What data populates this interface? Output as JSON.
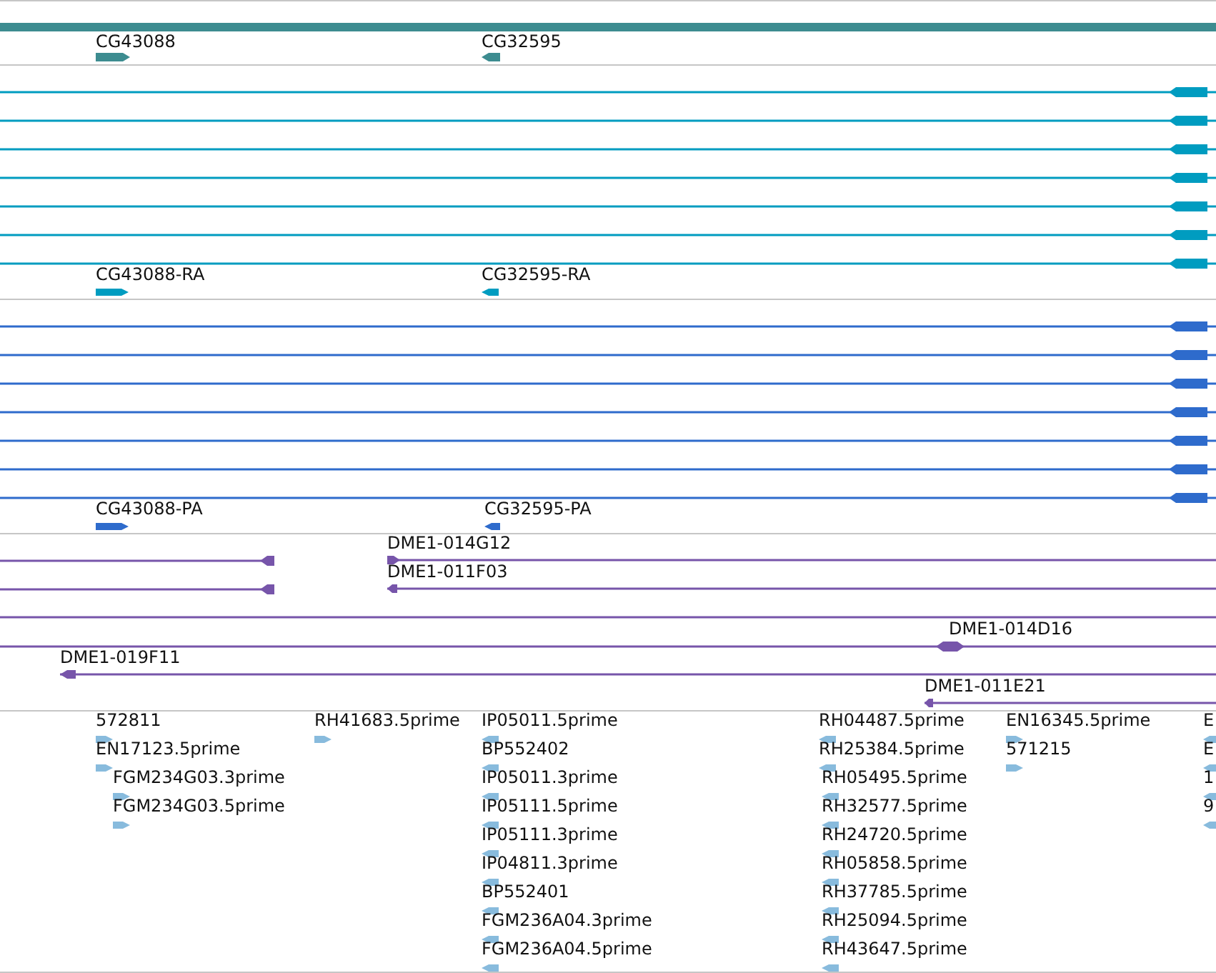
{
  "tracks": [
    {
      "kind": "gene",
      "features": [
        {
          "label": "CG43088",
          "forward": true,
          "reverse": false
        },
        {
          "label": "CG32595",
          "forward": false,
          "reverse": true
        }
      ]
    },
    {
      "kind": "transcript",
      "features": [
        {
          "forward": false,
          "reverse": true
        },
        {
          "forward": false,
          "reverse": true
        },
        {
          "forward": false,
          "reverse": true
        },
        {
          "forward": false,
          "reverse": true
        },
        {
          "forward": false,
          "reverse": true
        },
        {
          "forward": false,
          "reverse": true
        },
        {
          "forward": false,
          "reverse": true
        },
        {
          "label": "CG43088-RA",
          "forward": true,
          "reverse": false
        },
        {
          "label": "CG32595-RA",
          "forward": false,
          "reverse": true
        }
      ]
    },
    {
      "kind": "protein",
      "features": [
        {
          "forward": false,
          "reverse": true
        },
        {
          "forward": false,
          "reverse": true
        },
        {
          "forward": false,
          "reverse": true
        },
        {
          "forward": false,
          "reverse": true
        },
        {
          "forward": false,
          "reverse": true
        },
        {
          "forward": false,
          "reverse": true
        },
        {
          "forward": false,
          "reverse": true
        },
        {
          "label": "CG43088-PA",
          "forward": true,
          "reverse": false
        },
        {
          "label": "CG32595-PA",
          "forward": false,
          "reverse": true
        }
      ]
    },
    {
      "kind": "clone",
      "features": [
        {
          "forward": false,
          "reverse": true
        },
        {
          "label": "DME1-014G12",
          "forward": true,
          "reverse": false
        },
        {
          "forward": false,
          "reverse": true
        },
        {
          "label": "DME1-011F03",
          "forward": false,
          "reverse": true
        },
        {
          "kind": "line"
        },
        {
          "label": "DME1-014D16",
          "forward": true,
          "reverse": true
        },
        {
          "label": "DME1-019F11",
          "forward": false,
          "reverse": true
        },
        {
          "label": "DME1-011E21",
          "forward": false,
          "reverse": true
        }
      ]
    },
    {
      "kind": "est",
      "features": [
        {
          "label": "572811",
          "forward": true,
          "reverse": false
        },
        {
          "label": "EN17123.5prime",
          "forward": true,
          "reverse": false
        },
        {
          "label": "FGM234G03.3prime",
          "forward": true,
          "reverse": false
        },
        {
          "label": "FGM234G03.5prime",
          "forward": true,
          "reverse": false
        },
        {
          "label": "RH41683.5prime",
          "forward": true,
          "reverse": false
        },
        {
          "label": "IP05011.5prime",
          "forward": false,
          "reverse": true
        },
        {
          "label": "BP552402",
          "forward": false,
          "reverse": true
        },
        {
          "label": "IP05011.3prime",
          "forward": false,
          "reverse": true
        },
        {
          "label": "IP05111.5prime",
          "forward": false,
          "reverse": true
        },
        {
          "label": "IP05111.3prime",
          "forward": false,
          "reverse": true
        },
        {
          "label": "IP04811.3prime",
          "forward": false,
          "reverse": true
        },
        {
          "label": "BP552401",
          "forward": false,
          "reverse": true
        },
        {
          "label": "FGM236A04.3prime",
          "forward": false,
          "reverse": true
        },
        {
          "label": "FGM236A04.5prime",
          "forward": false,
          "reverse": true
        },
        {
          "label": "RH04487.5prime",
          "forward": false,
          "reverse": true
        },
        {
          "label": "RH25384.5prime",
          "forward": false,
          "reverse": true
        },
        {
          "label": "RH05495.5prime",
          "forward": false,
          "reverse": true
        },
        {
          "label": "RH32577.5prime",
          "forward": false,
          "reverse": true
        },
        {
          "label": "RH24720.5prime",
          "forward": false,
          "reverse": true
        },
        {
          "label": "RH05858.5prime",
          "forward": false,
          "reverse": true
        },
        {
          "label": "RH37785.5prime",
          "forward": false,
          "reverse": true
        },
        {
          "label": "RH25094.5prime",
          "forward": false,
          "reverse": true
        },
        {
          "label": "RH43647.5prime",
          "forward": false,
          "reverse": true
        },
        {
          "label": "EN16345.5prime",
          "forward": true,
          "reverse": false
        },
        {
          "label": "571215",
          "forward": true,
          "reverse": false
        },
        {
          "label": "E",
          "forward": false,
          "reverse": true
        },
        {
          "label": "E",
          "forward": false,
          "reverse": true
        },
        {
          "label": "1",
          "forward": false,
          "reverse": true
        },
        {
          "label": "9",
          "forward": false,
          "reverse": true
        }
      ]
    }
  ]
}
